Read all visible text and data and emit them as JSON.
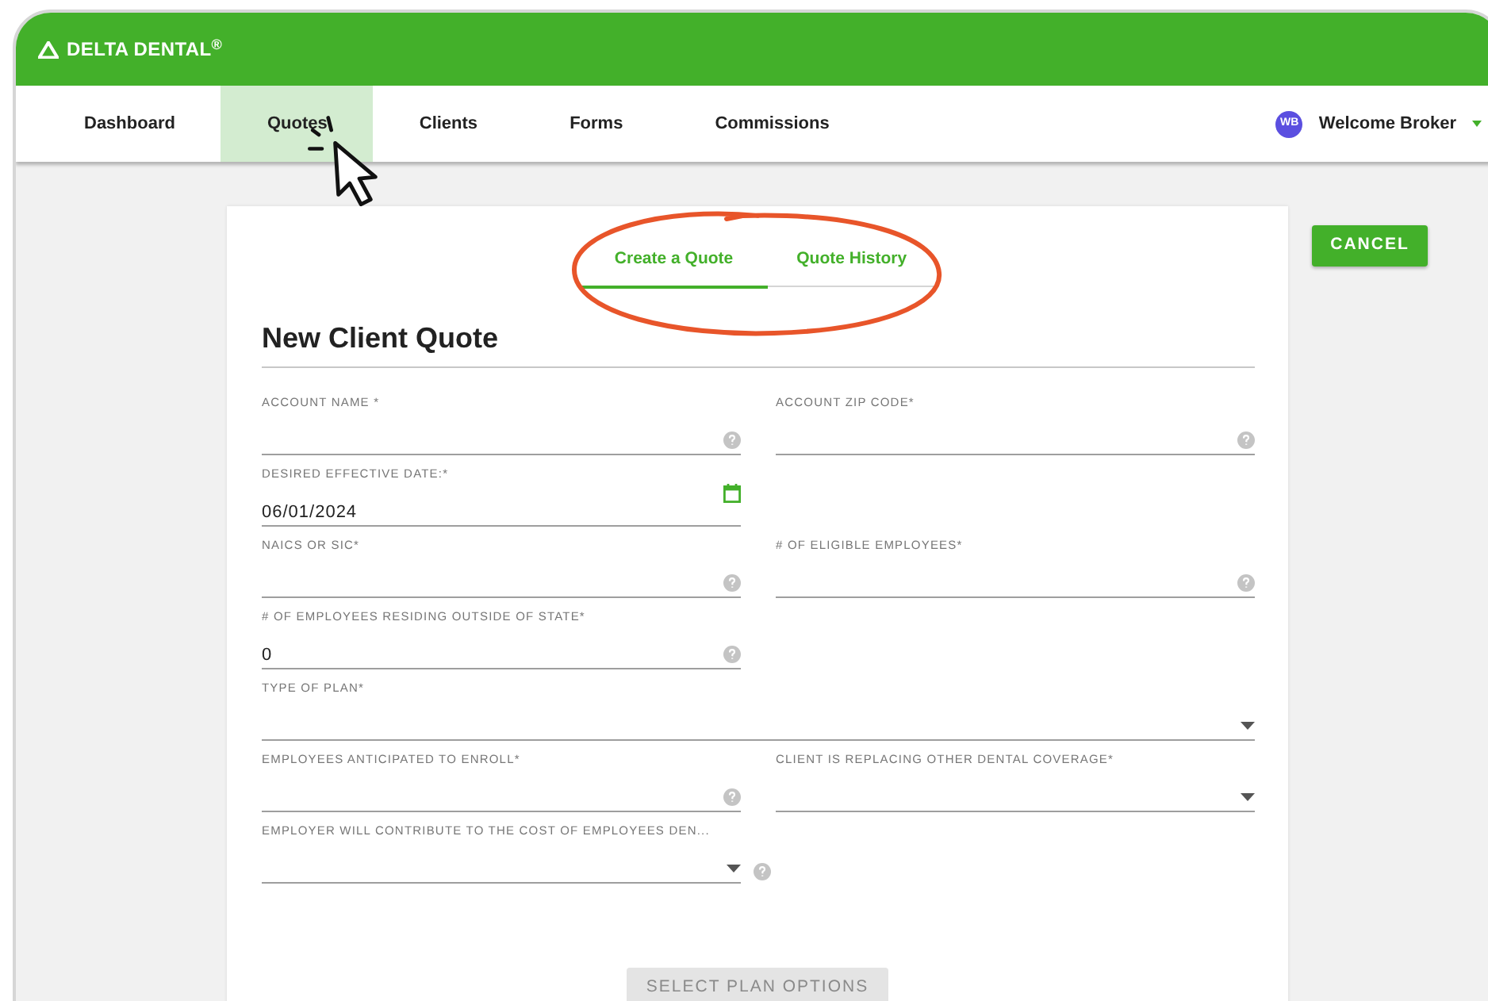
{
  "header": {
    "logo": "DELTA DENTAL$^{®}$"
  },
  "nav": {
    "items": [
      {
        "label": "Dashboard",
        "selected": false
      },
      {
        "label": "Quotes",
        "selected": true
      },
      {
        "label": "Clients",
        "selected": false
      },
      {
        "label": "Forms",
        "selected": false
      },
      {
        "label": "Commissions",
        "selected": false
      }
    ],
    "user": {
      "initials": "WB",
      "name": "Welcome Broker"
    }
  },
  "cancel_button": "CANCEL",
  "tabs": [
    {
      "label": "Create a Quote",
      "selected": true
    },
    {
      "label": "Quote History",
      "selected": false
    }
  ],
  "title": "New Client Quote",
  "rows": [
    {
      "fields": [
        {
          "kind": "text",
          "label": "ACCOUNT NAME *",
          "help": true
        },
        {
          "kind": "text",
          "label": "ACCOUNT ZIP CODE*",
          "help": true
        }
      ]
    },
    {
      "fields": [
        {
          "kind": "date",
          "label": "DESIRED EFFECTIVE DATE:*",
          "value": "06/01/2024",
          "help": false
        }
      ]
    },
    {
      "fields": [
        {
          "kind": "text",
          "label": "NAICS OR SIC*",
          "help": true
        },
        {
          "kind": "text",
          "label": "# OF ELIGIBLE EMPLOYEES*",
          "help": true
        }
      ]
    },
    {
      "fields": [
        {
          "kind": "text",
          "label": "# OF EMPLOYEES RESIDING OUTSIDE OF STATE*",
          "value": "0",
          "help": true
        }
      ]
    },
    {
      "wide": true,
      "fields": [
        {
          "kind": "select",
          "label": "TYPE OF PLAN*",
          "help": false
        }
      ]
    },
    {
      "fields": [
        {
          "kind": "text",
          "label": "EMPLOYEES ANTICIPATED TO ENROLL*",
          "help": true
        },
        {
          "kind": "select",
          "label": "CLIENT IS REPLACING OTHER DENTAL COVERAGE*",
          "help": false
        }
      ]
    },
    {
      "fields": [
        {
          "kind": "select",
          "label": "EMPLOYER WILL CONTRIBUTE TO THE COST OF EMPLOYEES DEN...",
          "help": true
        }
      ]
    }
  ],
  "submit": {
    "label": "SELECT PLAN OPTIONS",
    "disabled": true
  }
}
